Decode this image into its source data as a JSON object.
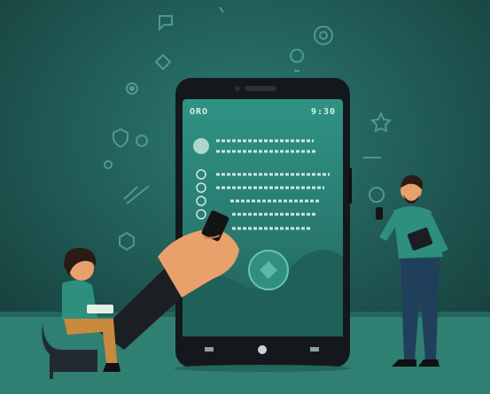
{
  "colors": {
    "background": "#1f5a55",
    "floor": "#2f7f73",
    "phone_body": "#14181c",
    "phone_screen": "#2c8a7e",
    "scribble": "#cfe9e2",
    "person_shirt": "#2f8f7e",
    "skin": "#e9a06a"
  },
  "phone": {
    "status_left": "ORO",
    "status_right": "9:30"
  },
  "icons": [
    "chat-bubble-icon",
    "lightbulb-icon",
    "star-icon",
    "diamond-icon",
    "target-icon",
    "plant-icon",
    "hexagon-icon",
    "circle-dot-icon",
    "shield-icon",
    "gear-icon"
  ]
}
